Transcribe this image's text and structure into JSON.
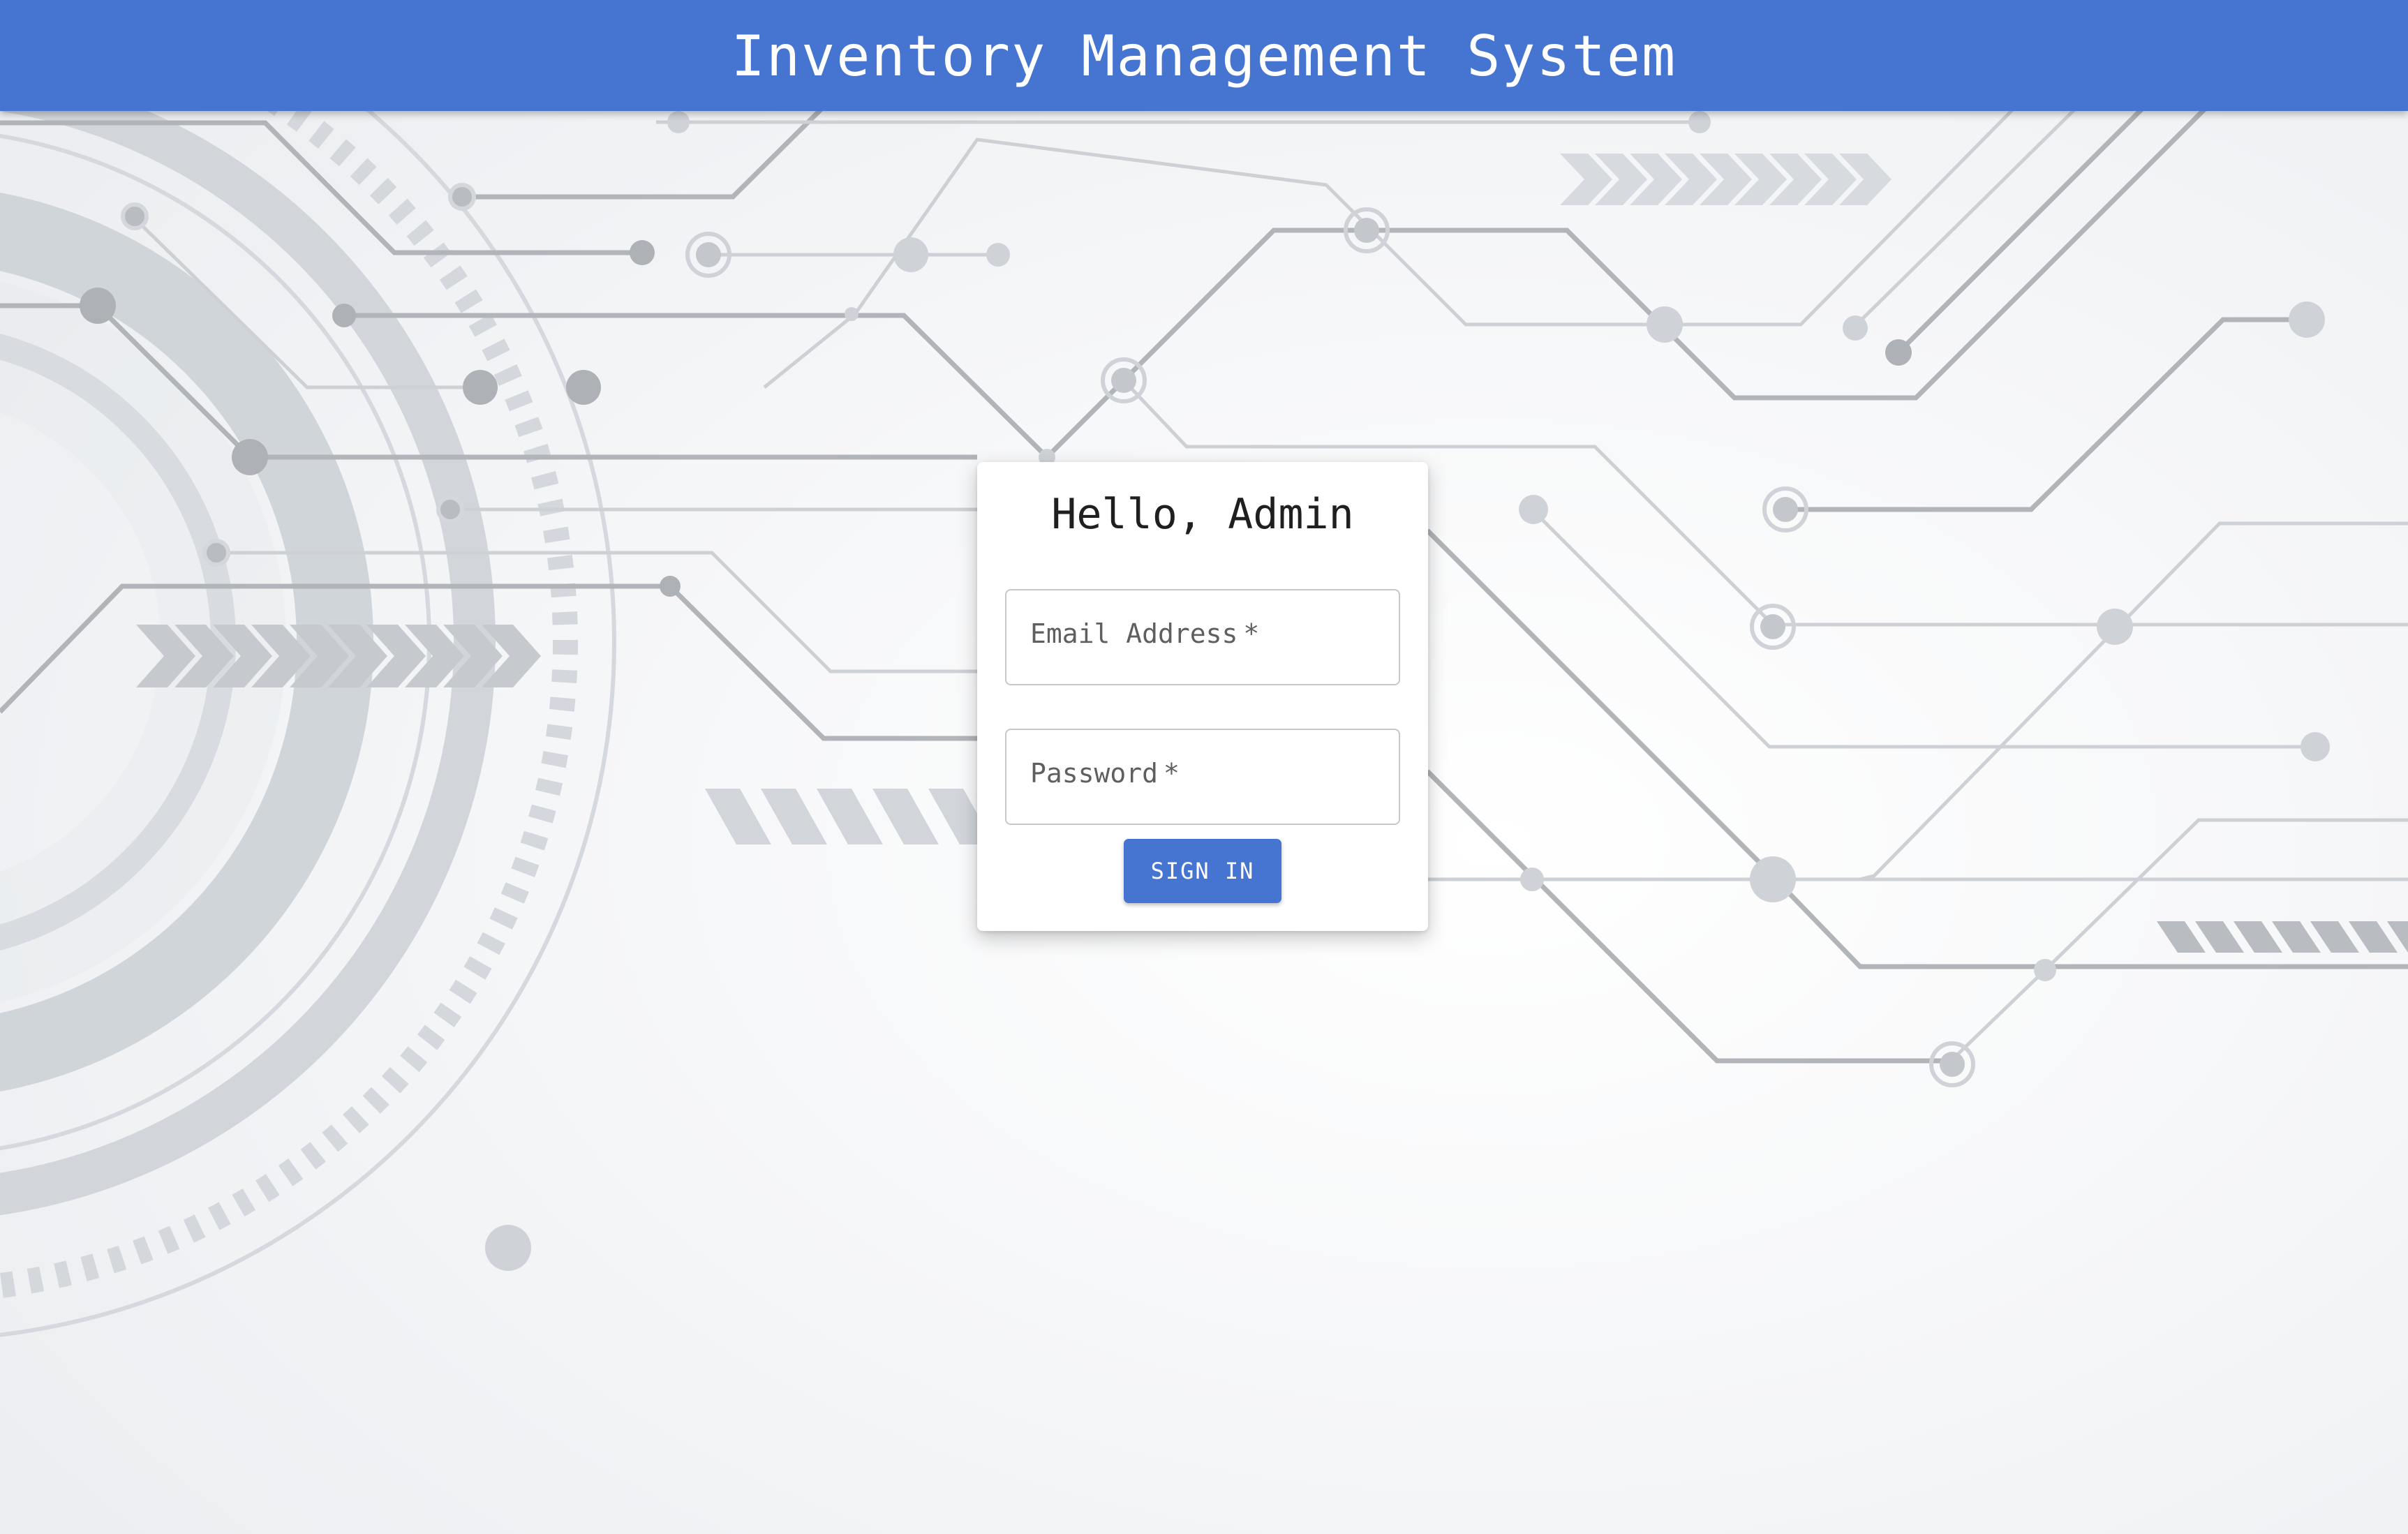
{
  "app_bar": {
    "title": "Inventory Management System"
  },
  "login": {
    "greeting": "Hello, Admin",
    "email_label": "Email Address",
    "password_label": "Password",
    "required_marker": "*",
    "sign_in_label": "SIGN IN"
  },
  "colors": {
    "primary": "#4675d1",
    "card": "#ffffff",
    "background": "#f3f4f6"
  }
}
